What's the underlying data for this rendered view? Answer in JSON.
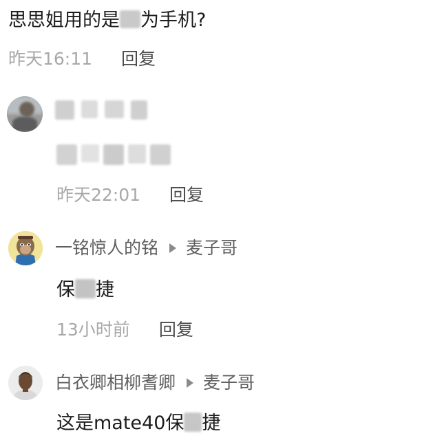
{
  "comment_top": {
    "text_before": "思思姐用的是",
    "text_after": "为手机?",
    "time": "昨天16:11",
    "reply_label": "回复"
  },
  "comment_2": {
    "time": "昨天22:01",
    "reply_label": "回复"
  },
  "comment_3": {
    "username": "一铭惊人的铭",
    "reply_to": "麦子哥",
    "text_before": "保",
    "text_after": "捷",
    "time": "13小时前",
    "reply_label": "回复"
  },
  "comment_4": {
    "username": "白衣卿相柳耆卿",
    "reply_to": "麦子哥",
    "text_before": "这是mate40保",
    "text_after": "捷"
  },
  "colors": {
    "text": "#1c1c1c",
    "meta": "#a8a8a8",
    "username": "#5f5f5f",
    "reply": "#4a4a4a"
  },
  "icons": [
    "reply-arrow-icon",
    "ape-avatar",
    "portrait-avatar"
  ]
}
